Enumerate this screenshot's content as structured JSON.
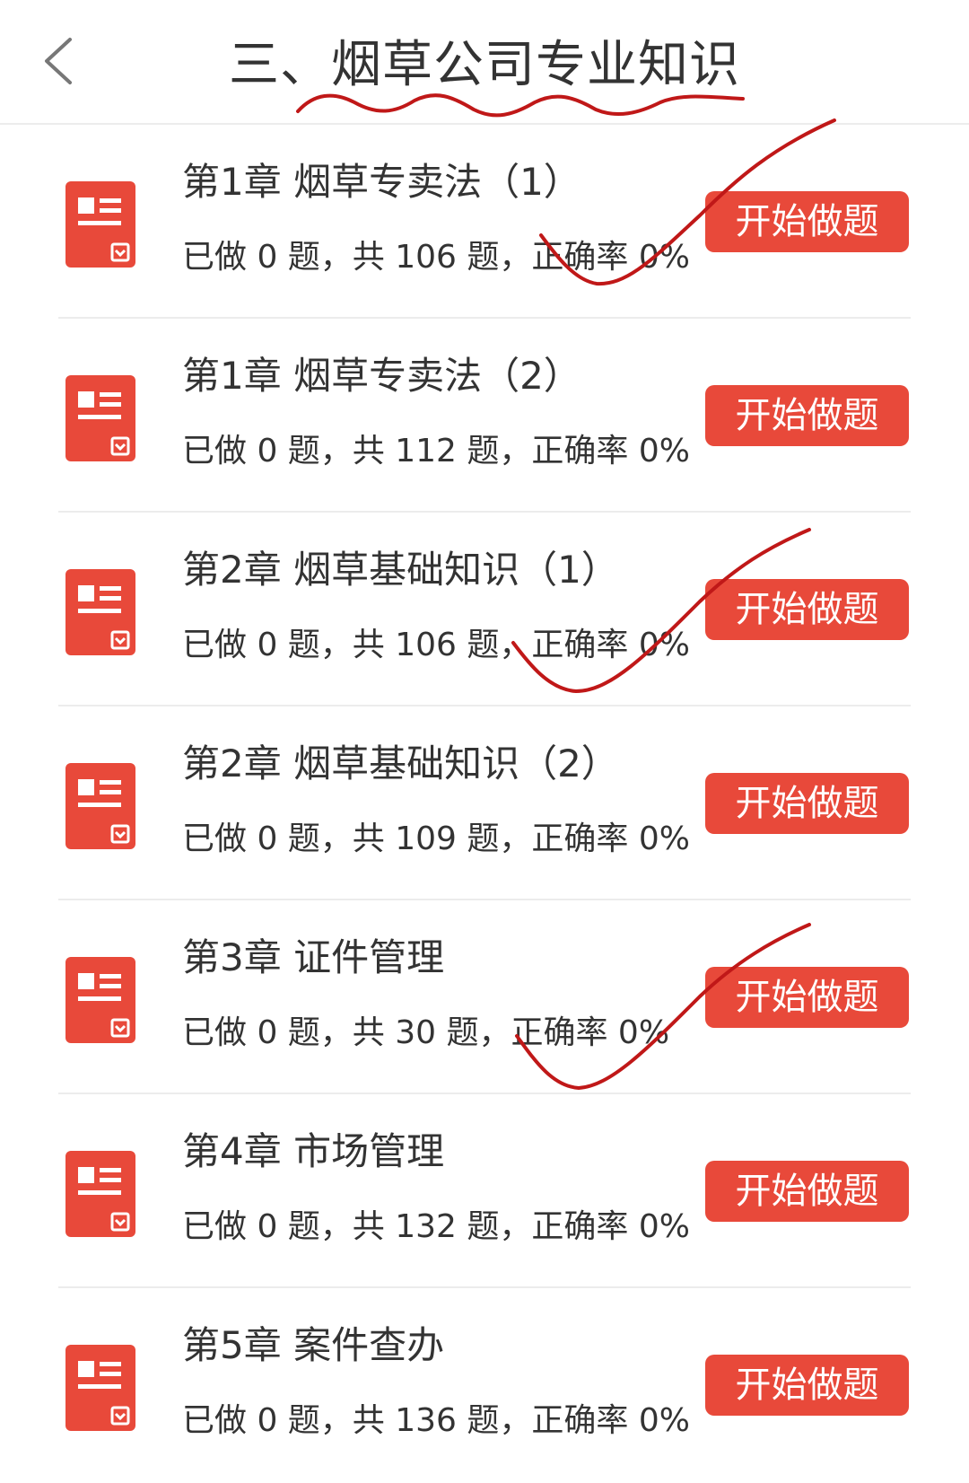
{
  "header": {
    "title": "三、烟草公司专业知识",
    "back_icon": "chevron-left-icon"
  },
  "colors": {
    "accent": "#e8493a",
    "annotation_ink": "#c01818",
    "text": "#333333",
    "divider": "#ececec"
  },
  "chapters": [
    {
      "title": "第1章 烟草专卖法（1）",
      "stats": "已做 0 题，共 106 题，正确率 0%",
      "button": "开始做题",
      "icon": "document-icon"
    },
    {
      "title": "第1章 烟草专卖法（2）",
      "stats": "已做 0 题，共 112 题，正确率 0%",
      "button": "开始做题",
      "icon": "document-icon"
    },
    {
      "title": "第2章 烟草基础知识（1）",
      "stats": "已做 0 题，共 106 题，正确率 0%",
      "button": "开始做题",
      "icon": "document-icon"
    },
    {
      "title": "第2章 烟草基础知识（2）",
      "stats": "已做 0 题，共 109 题，正确率 0%",
      "button": "开始做题",
      "icon": "document-icon"
    },
    {
      "title": "第3章 证件管理",
      "stats": "已做 0 题，共 30 题，正确率 0%",
      "button": "开始做题",
      "icon": "document-icon"
    },
    {
      "title": "第4章 市场管理",
      "stats": "已做 0 题，共 132 题，正确率 0%",
      "button": "开始做题",
      "icon": "document-icon"
    },
    {
      "title": "第5章 案件查办",
      "stats": "已做 0 题，共 136 题，正确率 0%",
      "button": "开始做题",
      "icon": "document-icon"
    }
  ]
}
